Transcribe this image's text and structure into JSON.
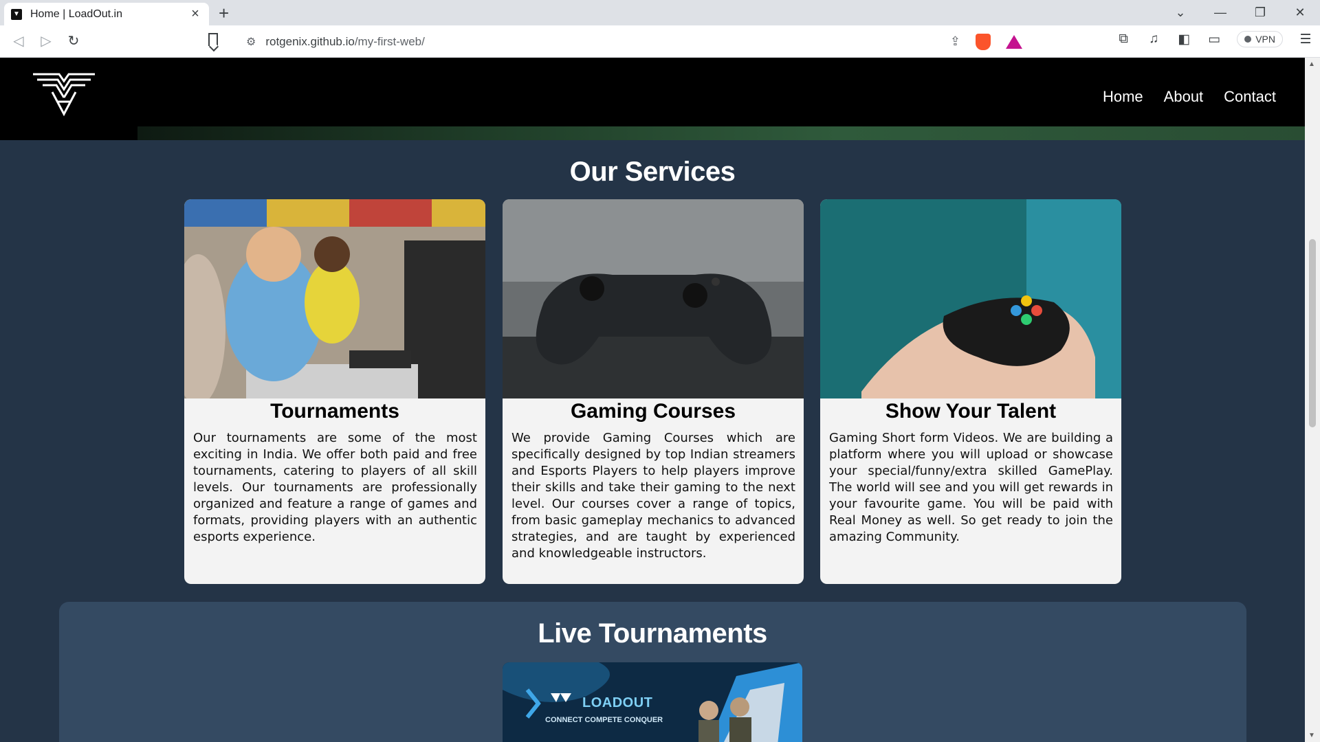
{
  "browser": {
    "tab_title": "Home | LoadOut.in",
    "url_host": "rotgenix.github.io",
    "url_path": "/my-first-web/",
    "vpn_label": "VPN"
  },
  "nav": {
    "items": [
      "Home",
      "About",
      "Contact"
    ]
  },
  "services": {
    "title": "Our Services",
    "cards": [
      {
        "title": "Tournaments",
        "text": "Our tournaments are some of the most exciting in India. We offer both paid and free tournaments, catering to players of all skill levels. Our tournaments are professionally organized and feature a range of games and formats, providing players with an authentic esports experience."
      },
      {
        "title": "Gaming Courses",
        "text": "We provide Gaming Courses which are specifically designed by top Indian streamers and Esports Players to help players improve their skills and take their gaming to the next level. Our courses cover a range of topics, from basic gameplay mechanics to advanced strategies, and are taught by experienced and knowledgeable instructors."
      },
      {
        "title": "Show Your Talent",
        "text": "Gaming Short form Videos. We are building a platform where you will upload or showcase your special/funny/extra skilled GamePlay. The world will see and you will get rewards in your favourite game. You will be paid with Real Money as well. So get ready to join the amazing Community."
      }
    ]
  },
  "live": {
    "title": "Live Tournaments",
    "banner_brand": "LOADOUT",
    "banner_tagline": "CONNECT COMPETE CONQUER"
  },
  "colors": {
    "page_bg": "#243447",
    "header_bg": "#000000",
    "card_bg": "#f3f3f3",
    "live_box_bg": "#344a62"
  }
}
